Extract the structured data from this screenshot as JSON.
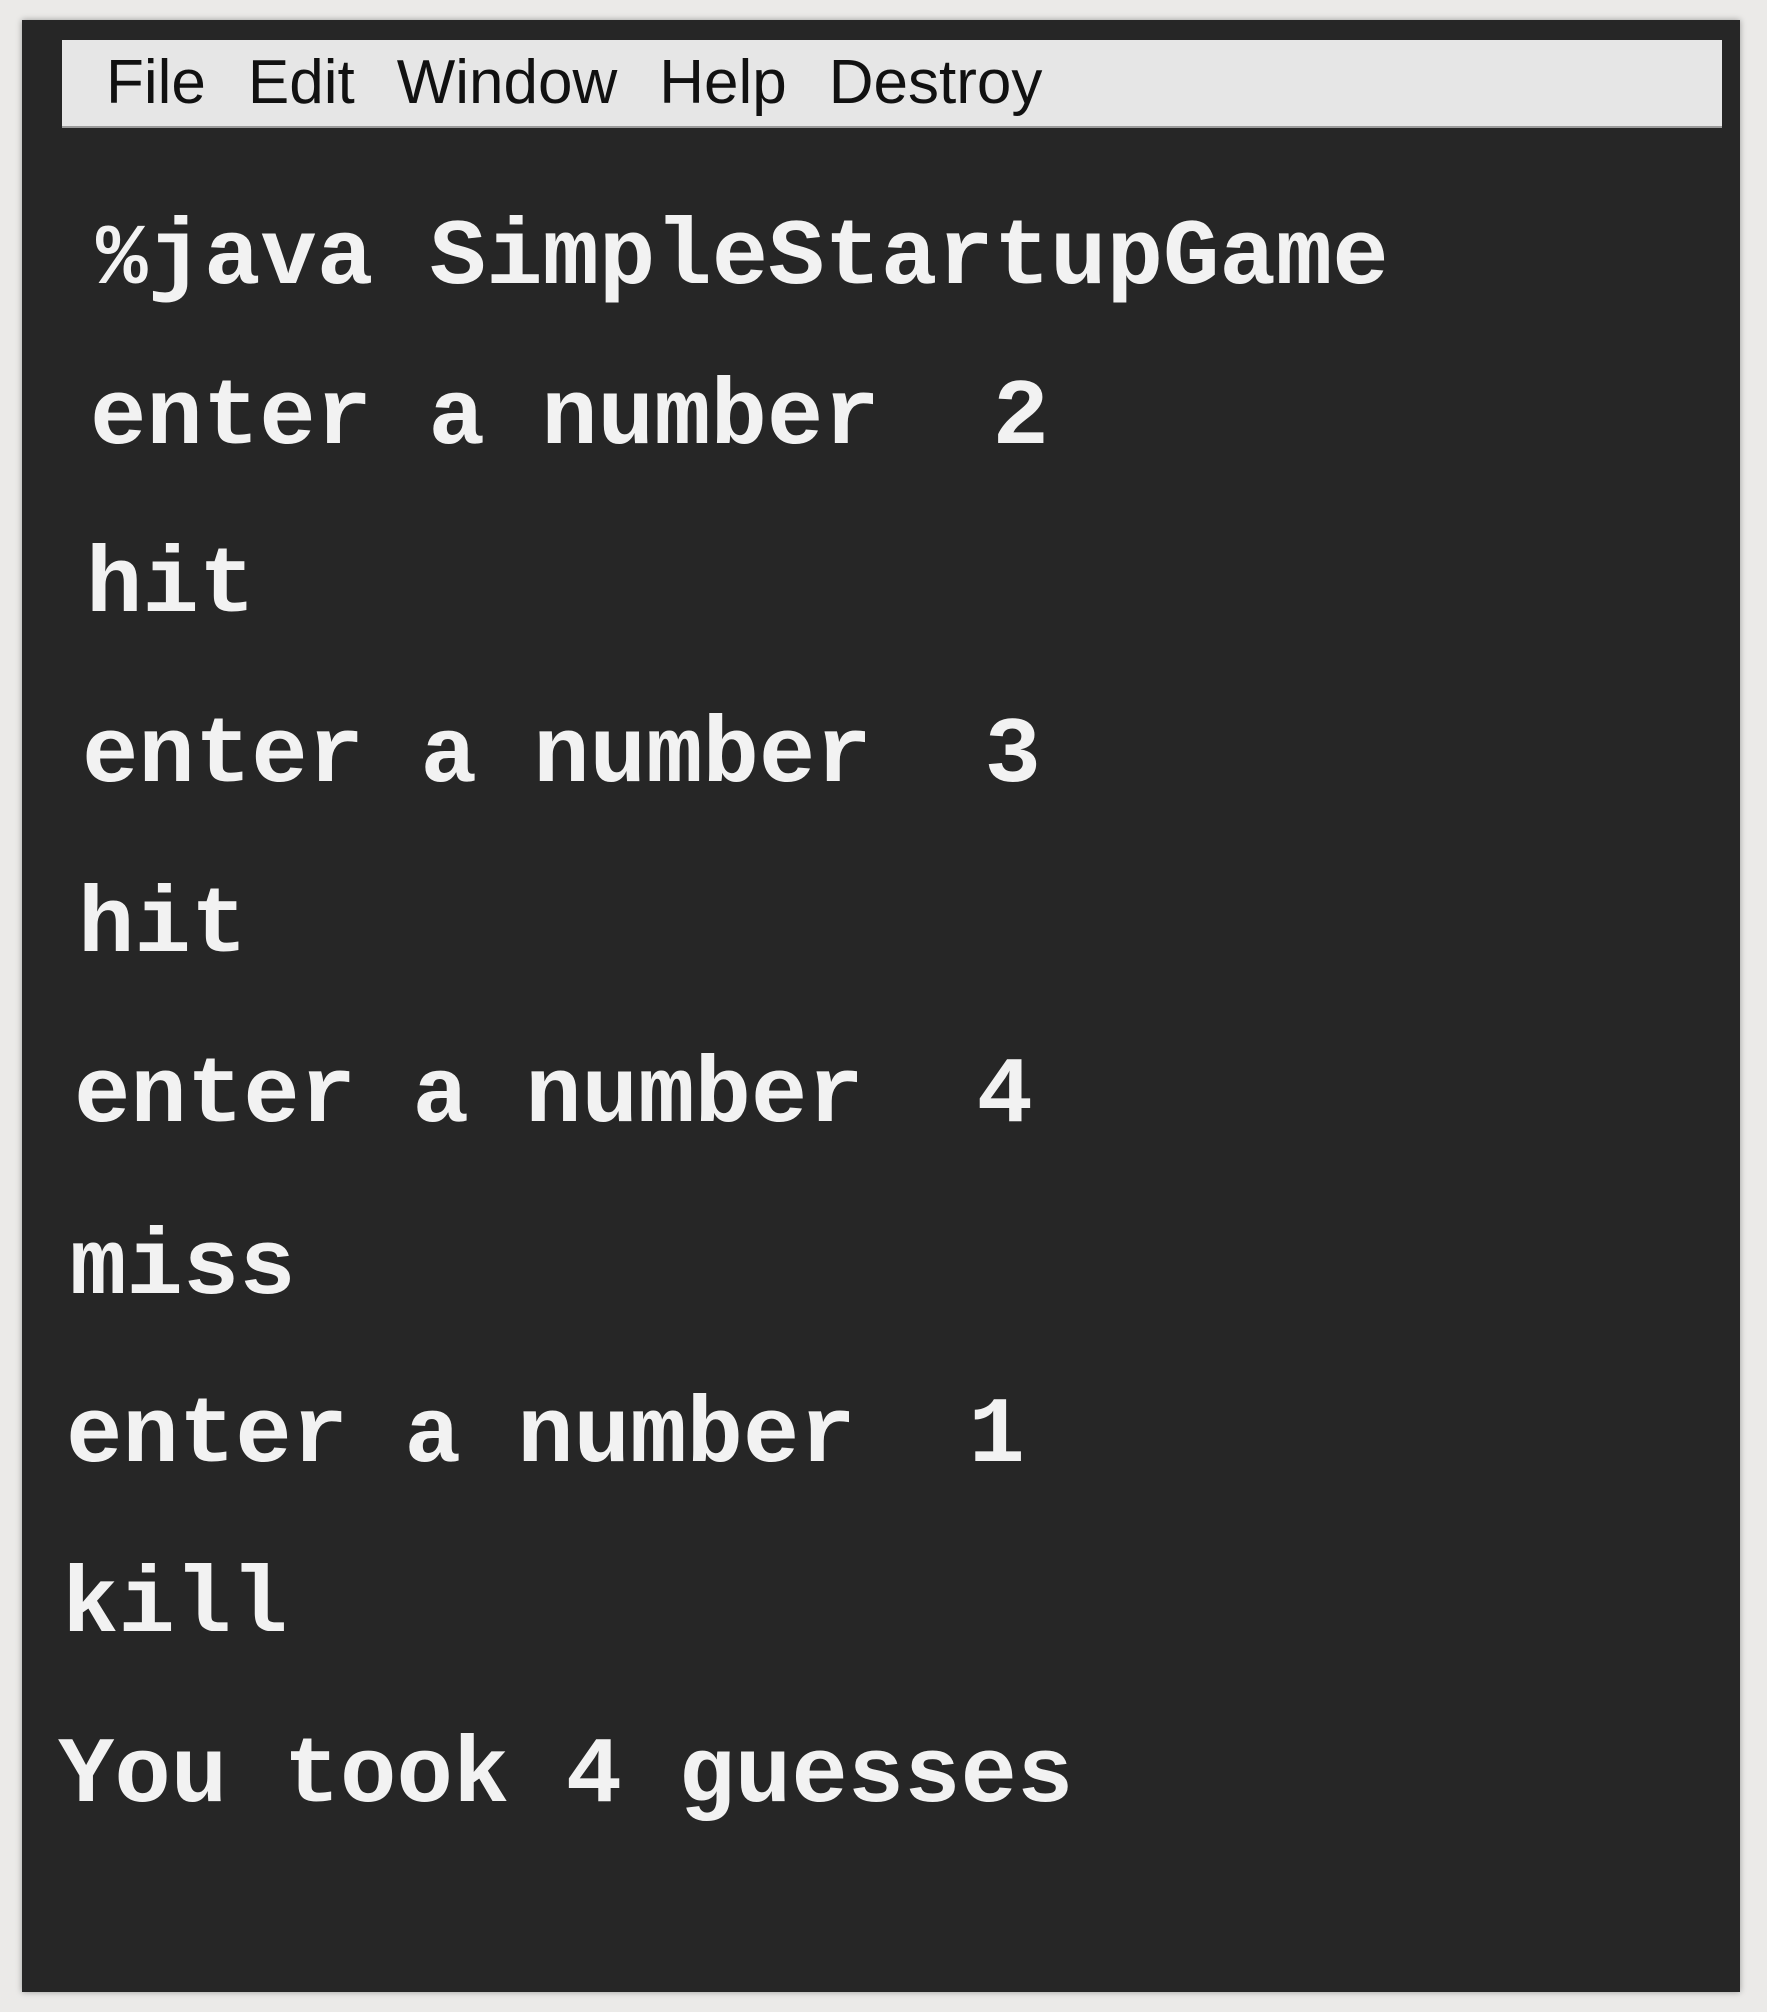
{
  "menu": {
    "items": [
      "File",
      "Edit",
      "Window",
      "Help",
      "Destroy"
    ]
  },
  "console": {
    "prompt_symbol": "%",
    "command": "java SimpleStartupGame",
    "lines": [
      "enter a number  2",
      "hit",
      "enter a number  3",
      "hit",
      "enter a number  4",
      "miss",
      "enter a number  1",
      "kill",
      "You took 4 guesses"
    ]
  },
  "colors": {
    "terminal_background": "#262626",
    "terminal_text": "#f2f2f2",
    "menu_background": "#e6e6e6",
    "menu_text": "#111111"
  }
}
